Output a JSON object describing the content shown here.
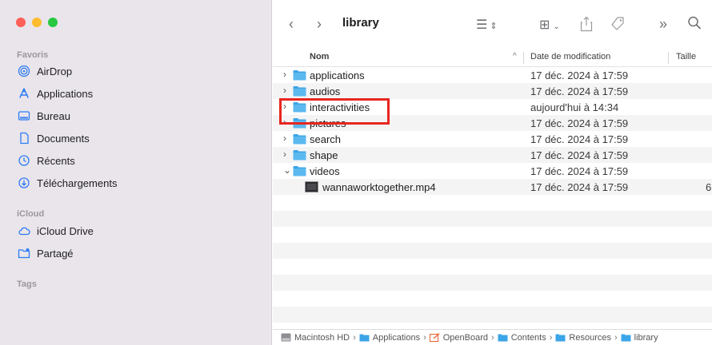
{
  "sidebar": {
    "sections": [
      {
        "label": "Favoris"
      },
      {
        "label": "iCloud"
      },
      {
        "label": "Tags"
      }
    ],
    "favoris": [
      {
        "label": "AirDrop",
        "icon": "airdrop-icon"
      },
      {
        "label": "Applications",
        "icon": "applications-icon"
      },
      {
        "label": "Bureau",
        "icon": "desktop-icon"
      },
      {
        "label": "Documents",
        "icon": "document-icon"
      },
      {
        "label": "Récents",
        "icon": "clock-icon"
      },
      {
        "label": "Téléchargements",
        "icon": "download-icon"
      }
    ],
    "icloud": [
      {
        "label": "iCloud Drive",
        "icon": "cloud-icon"
      },
      {
        "label": "Partagé",
        "icon": "shared-folder-icon"
      }
    ]
  },
  "toolbar": {
    "back": "‹",
    "forward": "›",
    "title": "library",
    "list_view": "☰",
    "group": "⊞",
    "overflow": "»",
    "search": "⌕"
  },
  "columns": {
    "name": "Nom",
    "date": "Date de modification",
    "size": "Taille",
    "sort_indicator": "^"
  },
  "files": [
    {
      "name": "applications",
      "date": "17 déc. 2024 à 17:59",
      "type": "folder",
      "chevron": "›"
    },
    {
      "name": "audios",
      "date": "17 déc. 2024 à 17:59",
      "type": "folder",
      "chevron": "›"
    },
    {
      "name": "interactivities",
      "date": "aujourd'hui à 14:34",
      "type": "folder",
      "chevron": "›"
    },
    {
      "name": "pictures",
      "date": "17 déc. 2024 à 17:59",
      "type": "folder",
      "chevron": "›"
    },
    {
      "name": "search",
      "date": "17 déc. 2024 à 17:59",
      "type": "folder",
      "chevron": "›"
    },
    {
      "name": "shape",
      "date": "17 déc. 2024 à 17:59",
      "type": "folder",
      "chevron": "›"
    },
    {
      "name": "videos",
      "date": "17 déc. 2024 à 17:59",
      "type": "folder",
      "chevron": "⌄"
    },
    {
      "name": "wannaworktogether.mp4",
      "date": "17 déc. 2024 à 17:59",
      "type": "video",
      "size": "6"
    }
  ],
  "pathbar": [
    {
      "label": "Macintosh HD",
      "icon": "disk-icon"
    },
    {
      "label": "Applications",
      "icon": "folder-icon"
    },
    {
      "label": "OpenBoard",
      "icon": "app-icon"
    },
    {
      "label": "Contents",
      "icon": "folder-icon"
    },
    {
      "label": "Resources",
      "icon": "folder-icon"
    },
    {
      "label": "library",
      "icon": "folder-icon"
    }
  ],
  "colors": {
    "accent": "#2d7cf6",
    "folder": "#3ca5e8",
    "highlight": "#e8261f",
    "sidebar_bg": "#e9e5ea"
  }
}
